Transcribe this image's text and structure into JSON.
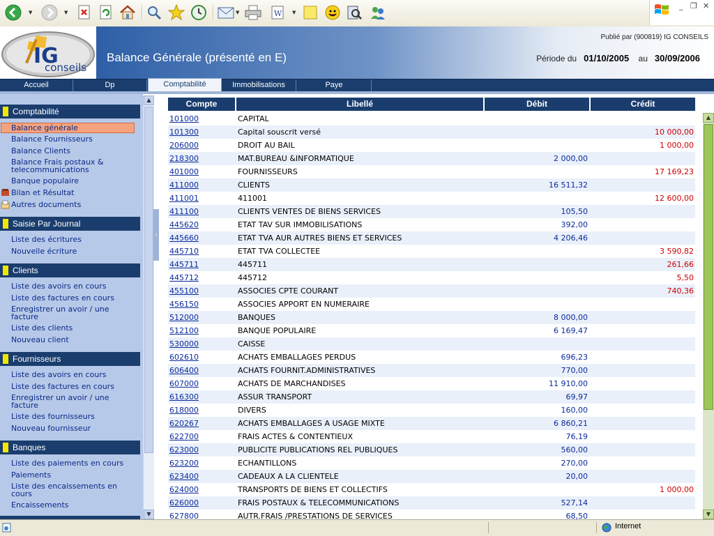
{
  "toolbar": {
    "icons": [
      "back-icon",
      "forward-icon",
      "stop-icon",
      "refresh-icon",
      "home-icon",
      "search-icon",
      "favorites-icon",
      "history-icon",
      "mail-icon",
      "print-icon",
      "edit-icon",
      "discuss-icon",
      "messenger-icon",
      "research-icon",
      "contacts-icon"
    ]
  },
  "header": {
    "title": "Balance Générale (présenté en E)",
    "publisher": "Publié par (900819) IG CONSEILS",
    "period_label": "Période du",
    "period_from": "01/10/2005",
    "period_to_label": "au",
    "period_to": "30/09/2006",
    "logo_text": "IG",
    "logo_sub": "conseils"
  },
  "nav": {
    "tabs": [
      "Accueil",
      "Dp",
      "Comptabilité",
      "Immobilisations",
      "Paye"
    ],
    "active": "Comptabilité"
  },
  "sidebar": {
    "sections": [
      {
        "title": "Comptabilité",
        "items": [
          "Balance générale",
          "Balance Fournisseurs",
          "Balance Clients",
          "Balance Frais postaux & telecommunications",
          "Banque populaire",
          "Bilan et Résultat",
          "Autres documents"
        ]
      },
      {
        "title": "Saisie Par Journal",
        "items": [
          "Liste des écritures",
          "Nouvelle écriture"
        ]
      },
      {
        "title": "Clients",
        "items": [
          "Liste des avoirs en cours",
          "Liste des factures en cours",
          "Enregistrer un avoir / une facture",
          "Liste des clients",
          "Nouveau client"
        ]
      },
      {
        "title": "Fournisseurs",
        "items": [
          "Liste des avoirs en cours",
          "Liste des factures en cours",
          "Enregistrer un avoir / une facture",
          "Liste des fournisseurs",
          "Nouveau fournisseur"
        ]
      },
      {
        "title": "Banques",
        "items": [
          "Liste des paiements en cours",
          "Paiements",
          "Liste des encaissements en cours",
          "Encaissements"
        ]
      }
    ],
    "active_item": "Balance générale"
  },
  "table": {
    "columns": [
      "Compte",
      "Libellé",
      "Débit",
      "Crédit"
    ],
    "rows": [
      {
        "compte": "101000",
        "libelle": "CAPITAL",
        "debit": "",
        "credit": ""
      },
      {
        "compte": "101300",
        "libelle": "Capital souscrit versé",
        "debit": "",
        "credit": "10 000,00"
      },
      {
        "compte": "206000",
        "libelle": "DROIT AU BAIL",
        "debit": "",
        "credit": "1 000,00"
      },
      {
        "compte": "218300",
        "libelle": "MAT.BUREAU &INFORMATIQUE",
        "debit": "2 000,00",
        "credit": ""
      },
      {
        "compte": "401000",
        "libelle": "FOURNISSEURS",
        "debit": "",
        "credit": "17 169,23"
      },
      {
        "compte": "411000",
        "libelle": "CLIENTS",
        "debit": "16 511,32",
        "credit": ""
      },
      {
        "compte": "411001",
        "libelle": "411001",
        "debit": "",
        "credit": "12 600,00"
      },
      {
        "compte": "411100",
        "libelle": "CLIENTS VENTES DE BIENS SERVICES",
        "debit": "105,50",
        "credit": ""
      },
      {
        "compte": "445620",
        "libelle": "ETAT TAV SUR IMMOBILISATIONS",
        "debit": "392,00",
        "credit": ""
      },
      {
        "compte": "445660",
        "libelle": "ETAT TVA AUR AUTRES BIENS ET SERVICES",
        "debit": "4 206,46",
        "credit": ""
      },
      {
        "compte": "445710",
        "libelle": "ETAT TVA COLLECTEE",
        "debit": "",
        "credit": "3 590,82"
      },
      {
        "compte": "445711",
        "libelle": "445711",
        "debit": "",
        "credit": "261,66"
      },
      {
        "compte": "445712",
        "libelle": "445712",
        "debit": "",
        "credit": "5,50"
      },
      {
        "compte": "455100",
        "libelle": "ASSOCIES CPTE COURANT",
        "debit": "",
        "credit": "740,36"
      },
      {
        "compte": "456150",
        "libelle": "ASSOCIES APPORT EN NUMERAIRE",
        "debit": "",
        "credit": ""
      },
      {
        "compte": "512000",
        "libelle": "BANQUES",
        "debit": "8 000,00",
        "credit": ""
      },
      {
        "compte": "512100",
        "libelle": "BANQUE POPULAIRE",
        "debit": "6 169,47",
        "credit": ""
      },
      {
        "compte": "530000",
        "libelle": "CAISSE",
        "debit": "",
        "credit": ""
      },
      {
        "compte": "602610",
        "libelle": "ACHATS EMBALLAGES PERDUS",
        "debit": "696,23",
        "credit": ""
      },
      {
        "compte": "606400",
        "libelle": "ACHATS FOURNIT.ADMINISTRATIVES",
        "debit": "770,00",
        "credit": ""
      },
      {
        "compte": "607000",
        "libelle": "ACHATS DE MARCHANDISES",
        "debit": "11 910,00",
        "credit": ""
      },
      {
        "compte": "616300",
        "libelle": "ASSUR TRANSPORT",
        "debit": "69,97",
        "credit": ""
      },
      {
        "compte": "618000",
        "libelle": "DIVERS",
        "debit": "160,00",
        "credit": ""
      },
      {
        "compte": "620267",
        "libelle": "ACHATS EMBALLAGES A USAGE MIXTE",
        "debit": "6 860,21",
        "credit": ""
      },
      {
        "compte": "622700",
        "libelle": "FRAIS ACTES & CONTENTIEUX",
        "debit": "76,19",
        "credit": ""
      },
      {
        "compte": "623000",
        "libelle": "PUBLICITE PUBLICATIONS REL PUBLIQUES",
        "debit": "560,00",
        "credit": ""
      },
      {
        "compte": "623200",
        "libelle": "ECHANTILLONS",
        "debit": "270,00",
        "credit": ""
      },
      {
        "compte": "623400",
        "libelle": "CADEAUX A LA CLIENTELE",
        "debit": "20,00",
        "credit": ""
      },
      {
        "compte": "624000",
        "libelle": "TRANSPORTS DE BIENS ET COLLECTIFS",
        "debit": "",
        "credit": "1 000,00"
      },
      {
        "compte": "626000",
        "libelle": "FRAIS POSTAUX & TELECOMMUNICATIONS",
        "debit": "527,14",
        "credit": ""
      },
      {
        "compte": "627800",
        "libelle": "AUTR.FRAIS /PRESTATIONS DE SERVICES",
        "debit": "68,50",
        "credit": ""
      }
    ]
  },
  "status": {
    "zone": "Internet"
  },
  "colors": {
    "nav": "#1a3d6e",
    "sidebar": "#b7c9e8",
    "link": "#0a2a9a",
    "credit": "#cc0000",
    "active_item": "#f4a37f"
  }
}
